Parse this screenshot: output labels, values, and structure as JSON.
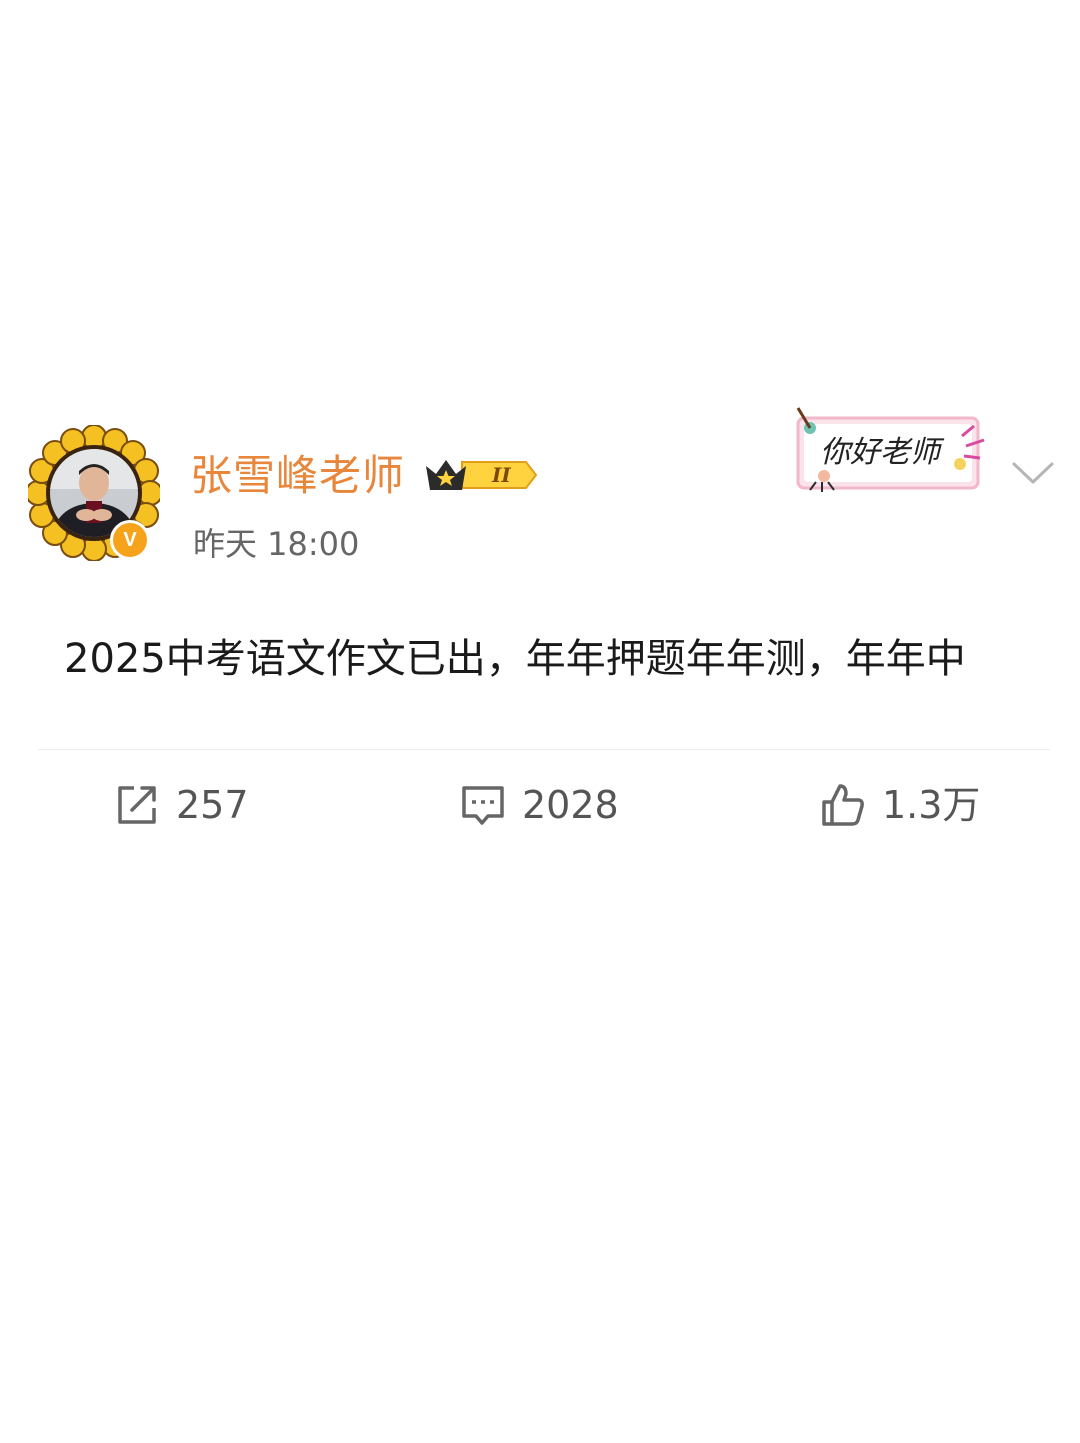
{
  "post": {
    "author": {
      "name": "张雪峰老师",
      "vip_level": "II",
      "avatar_icon": "teacher-avatar",
      "verified_icon": "verified-icon",
      "verified_label": "V"
    },
    "timestamp": "昨天 18:00",
    "sticker_text": "你好老师",
    "content": "2025中考语文作文已出，年年押题年年测，年年中",
    "actions": {
      "repost_count": "257",
      "comment_count": "2028",
      "like_count": "1.3万"
    }
  },
  "colors": {
    "username": "#e8863c",
    "verified": "#f7a21b",
    "sunflower": "#f5c021",
    "text": "#1a1a1a",
    "muted": "#666666"
  }
}
